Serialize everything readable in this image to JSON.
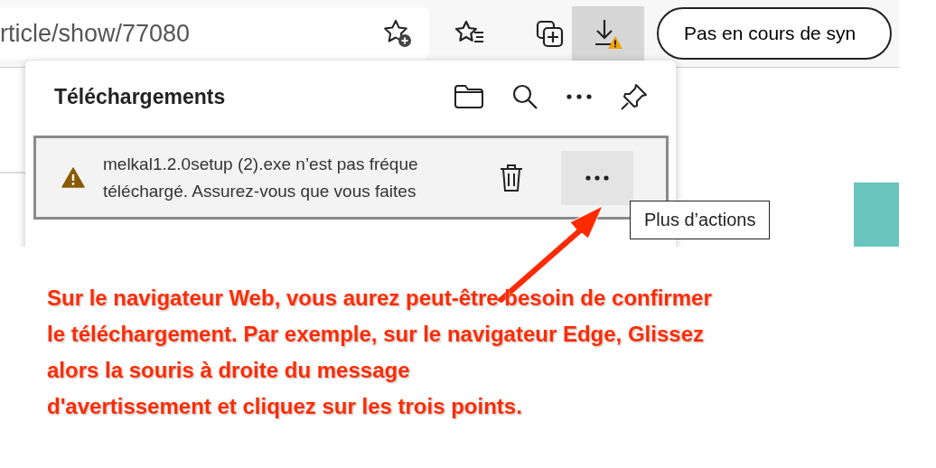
{
  "address_bar": {
    "url": "rticle/show/77080"
  },
  "download_button": {
    "selected": true,
    "warning": true
  },
  "sync_button": {
    "label": "Pas en cours de syn"
  },
  "downloads_panel": {
    "title": "Téléchargements",
    "items": [
      {
        "lines": [
          "melkal1.2.0setup (2).exe n’est pas fréque",
          "téléchargé. Assurez-vous que vous faites"
        ],
        "warning": true,
        "selected": true
      }
    ]
  },
  "tooltip": {
    "text": "Plus d’actions"
  },
  "annotation": {
    "lines": [
      "Sur le navigateur Web, vous aurez peut-être besoin de confirmer",
      "le téléchargement. Par exemple, sur le navigateur Edge, Glissez",
      "alors la souris à droite du message",
      "d'avertissement et cliquez sur les trois points."
    ]
  }
}
